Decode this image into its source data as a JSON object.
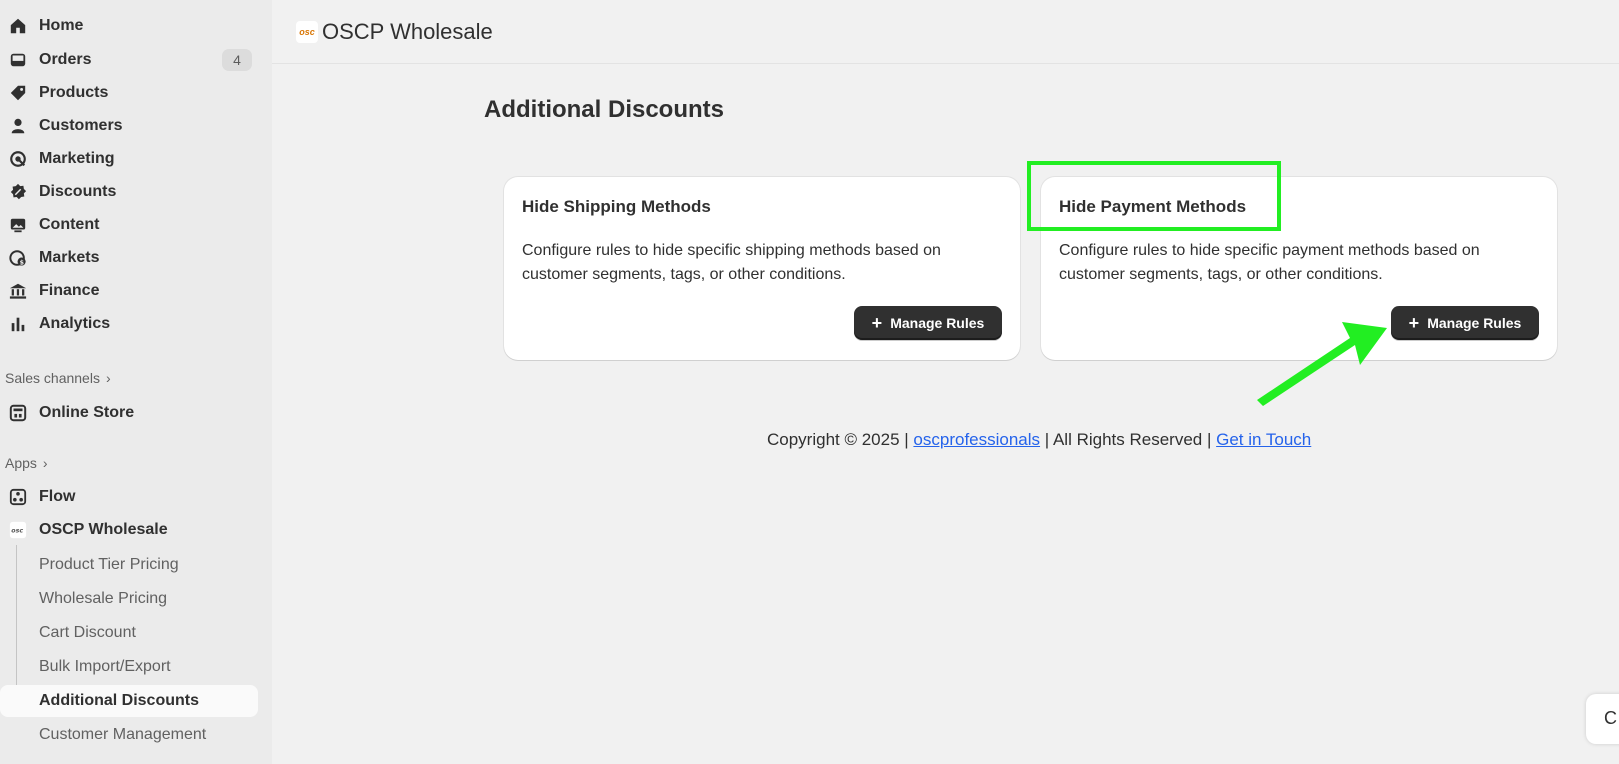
{
  "sidebar": {
    "nav": [
      {
        "label": "Home",
        "icon": "home-icon"
      },
      {
        "label": "Orders",
        "icon": "inbox-icon",
        "badge": "4"
      },
      {
        "label": "Products",
        "icon": "tag-icon"
      },
      {
        "label": "Customers",
        "icon": "person-icon"
      },
      {
        "label": "Marketing",
        "icon": "target-icon"
      },
      {
        "label": "Discounts",
        "icon": "discount-icon"
      },
      {
        "label": "Content",
        "icon": "image-icon"
      },
      {
        "label": "Markets",
        "icon": "globe-icon"
      },
      {
        "label": "Finance",
        "icon": "bank-icon"
      },
      {
        "label": "Analytics",
        "icon": "bar-chart-icon"
      }
    ],
    "sales_channels_label": "Sales channels",
    "online_store": "Online Store",
    "apps_label": "Apps",
    "flow": "Flow",
    "oscp_wholesale": "OSCP Wholesale",
    "sub_items": [
      "Product Tier Pricing",
      "Wholesale Pricing",
      "Cart Discount",
      "Bulk Import/Export",
      "Additional Discounts",
      "Customer Management"
    ]
  },
  "header": {
    "logo_text": "osc",
    "title": "OSCP Wholesale"
  },
  "main": {
    "page_title": "Additional Discounts",
    "cards": [
      {
        "title": "Hide Shipping Methods",
        "description": "Configure rules to hide specific shipping methods based on customer segments, tags, or other conditions.",
        "button": "Manage Rules"
      },
      {
        "title": "Hide Payment Methods",
        "description": "Configure rules to hide specific payment methods based on customer segments, tags, or other conditions.",
        "button": "Manage Rules"
      }
    ]
  },
  "footer": {
    "copyright": "Copyright © 2025 | ",
    "link1": "oscprofessionals",
    "middle": " | All Rights Reserved | ",
    "link2": "Get in Touch"
  },
  "corner_chip": "C",
  "colors": {
    "highlight": "#22ee22",
    "arrow": "#22ee22",
    "button_bg": "#303030",
    "link": "#2563eb"
  }
}
